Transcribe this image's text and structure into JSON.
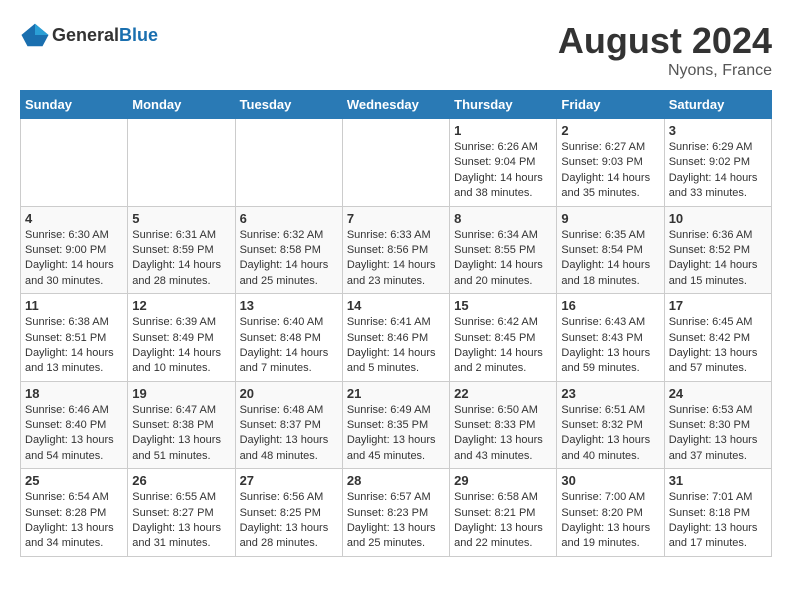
{
  "header": {
    "logo_general": "General",
    "logo_blue": "Blue",
    "month_year": "August 2024",
    "location": "Nyons, France"
  },
  "days_of_week": [
    "Sunday",
    "Monday",
    "Tuesday",
    "Wednesday",
    "Thursday",
    "Friday",
    "Saturday"
  ],
  "weeks": [
    [
      {
        "day": "",
        "info": ""
      },
      {
        "day": "",
        "info": ""
      },
      {
        "day": "",
        "info": ""
      },
      {
        "day": "",
        "info": ""
      },
      {
        "day": "1",
        "info": "Sunrise: 6:26 AM\nSunset: 9:04 PM\nDaylight: 14 hours and 38 minutes."
      },
      {
        "day": "2",
        "info": "Sunrise: 6:27 AM\nSunset: 9:03 PM\nDaylight: 14 hours and 35 minutes."
      },
      {
        "day": "3",
        "info": "Sunrise: 6:29 AM\nSunset: 9:02 PM\nDaylight: 14 hours and 33 minutes."
      }
    ],
    [
      {
        "day": "4",
        "info": "Sunrise: 6:30 AM\nSunset: 9:00 PM\nDaylight: 14 hours and 30 minutes."
      },
      {
        "day": "5",
        "info": "Sunrise: 6:31 AM\nSunset: 8:59 PM\nDaylight: 14 hours and 28 minutes."
      },
      {
        "day": "6",
        "info": "Sunrise: 6:32 AM\nSunset: 8:58 PM\nDaylight: 14 hours and 25 minutes."
      },
      {
        "day": "7",
        "info": "Sunrise: 6:33 AM\nSunset: 8:56 PM\nDaylight: 14 hours and 23 minutes."
      },
      {
        "day": "8",
        "info": "Sunrise: 6:34 AM\nSunset: 8:55 PM\nDaylight: 14 hours and 20 minutes."
      },
      {
        "day": "9",
        "info": "Sunrise: 6:35 AM\nSunset: 8:54 PM\nDaylight: 14 hours and 18 minutes."
      },
      {
        "day": "10",
        "info": "Sunrise: 6:36 AM\nSunset: 8:52 PM\nDaylight: 14 hours and 15 minutes."
      }
    ],
    [
      {
        "day": "11",
        "info": "Sunrise: 6:38 AM\nSunset: 8:51 PM\nDaylight: 14 hours and 13 minutes."
      },
      {
        "day": "12",
        "info": "Sunrise: 6:39 AM\nSunset: 8:49 PM\nDaylight: 14 hours and 10 minutes."
      },
      {
        "day": "13",
        "info": "Sunrise: 6:40 AM\nSunset: 8:48 PM\nDaylight: 14 hours and 7 minutes."
      },
      {
        "day": "14",
        "info": "Sunrise: 6:41 AM\nSunset: 8:46 PM\nDaylight: 14 hours and 5 minutes."
      },
      {
        "day": "15",
        "info": "Sunrise: 6:42 AM\nSunset: 8:45 PM\nDaylight: 14 hours and 2 minutes."
      },
      {
        "day": "16",
        "info": "Sunrise: 6:43 AM\nSunset: 8:43 PM\nDaylight: 13 hours and 59 minutes."
      },
      {
        "day": "17",
        "info": "Sunrise: 6:45 AM\nSunset: 8:42 PM\nDaylight: 13 hours and 57 minutes."
      }
    ],
    [
      {
        "day": "18",
        "info": "Sunrise: 6:46 AM\nSunset: 8:40 PM\nDaylight: 13 hours and 54 minutes."
      },
      {
        "day": "19",
        "info": "Sunrise: 6:47 AM\nSunset: 8:38 PM\nDaylight: 13 hours and 51 minutes."
      },
      {
        "day": "20",
        "info": "Sunrise: 6:48 AM\nSunset: 8:37 PM\nDaylight: 13 hours and 48 minutes."
      },
      {
        "day": "21",
        "info": "Sunrise: 6:49 AM\nSunset: 8:35 PM\nDaylight: 13 hours and 45 minutes."
      },
      {
        "day": "22",
        "info": "Sunrise: 6:50 AM\nSunset: 8:33 PM\nDaylight: 13 hours and 43 minutes."
      },
      {
        "day": "23",
        "info": "Sunrise: 6:51 AM\nSunset: 8:32 PM\nDaylight: 13 hours and 40 minutes."
      },
      {
        "day": "24",
        "info": "Sunrise: 6:53 AM\nSunset: 8:30 PM\nDaylight: 13 hours and 37 minutes."
      }
    ],
    [
      {
        "day": "25",
        "info": "Sunrise: 6:54 AM\nSunset: 8:28 PM\nDaylight: 13 hours and 34 minutes."
      },
      {
        "day": "26",
        "info": "Sunrise: 6:55 AM\nSunset: 8:27 PM\nDaylight: 13 hours and 31 minutes."
      },
      {
        "day": "27",
        "info": "Sunrise: 6:56 AM\nSunset: 8:25 PM\nDaylight: 13 hours and 28 minutes."
      },
      {
        "day": "28",
        "info": "Sunrise: 6:57 AM\nSunset: 8:23 PM\nDaylight: 13 hours and 25 minutes."
      },
      {
        "day": "29",
        "info": "Sunrise: 6:58 AM\nSunset: 8:21 PM\nDaylight: 13 hours and 22 minutes."
      },
      {
        "day": "30",
        "info": "Sunrise: 7:00 AM\nSunset: 8:20 PM\nDaylight: 13 hours and 19 minutes."
      },
      {
        "day": "31",
        "info": "Sunrise: 7:01 AM\nSunset: 8:18 PM\nDaylight: 13 hours and 17 minutes."
      }
    ]
  ]
}
